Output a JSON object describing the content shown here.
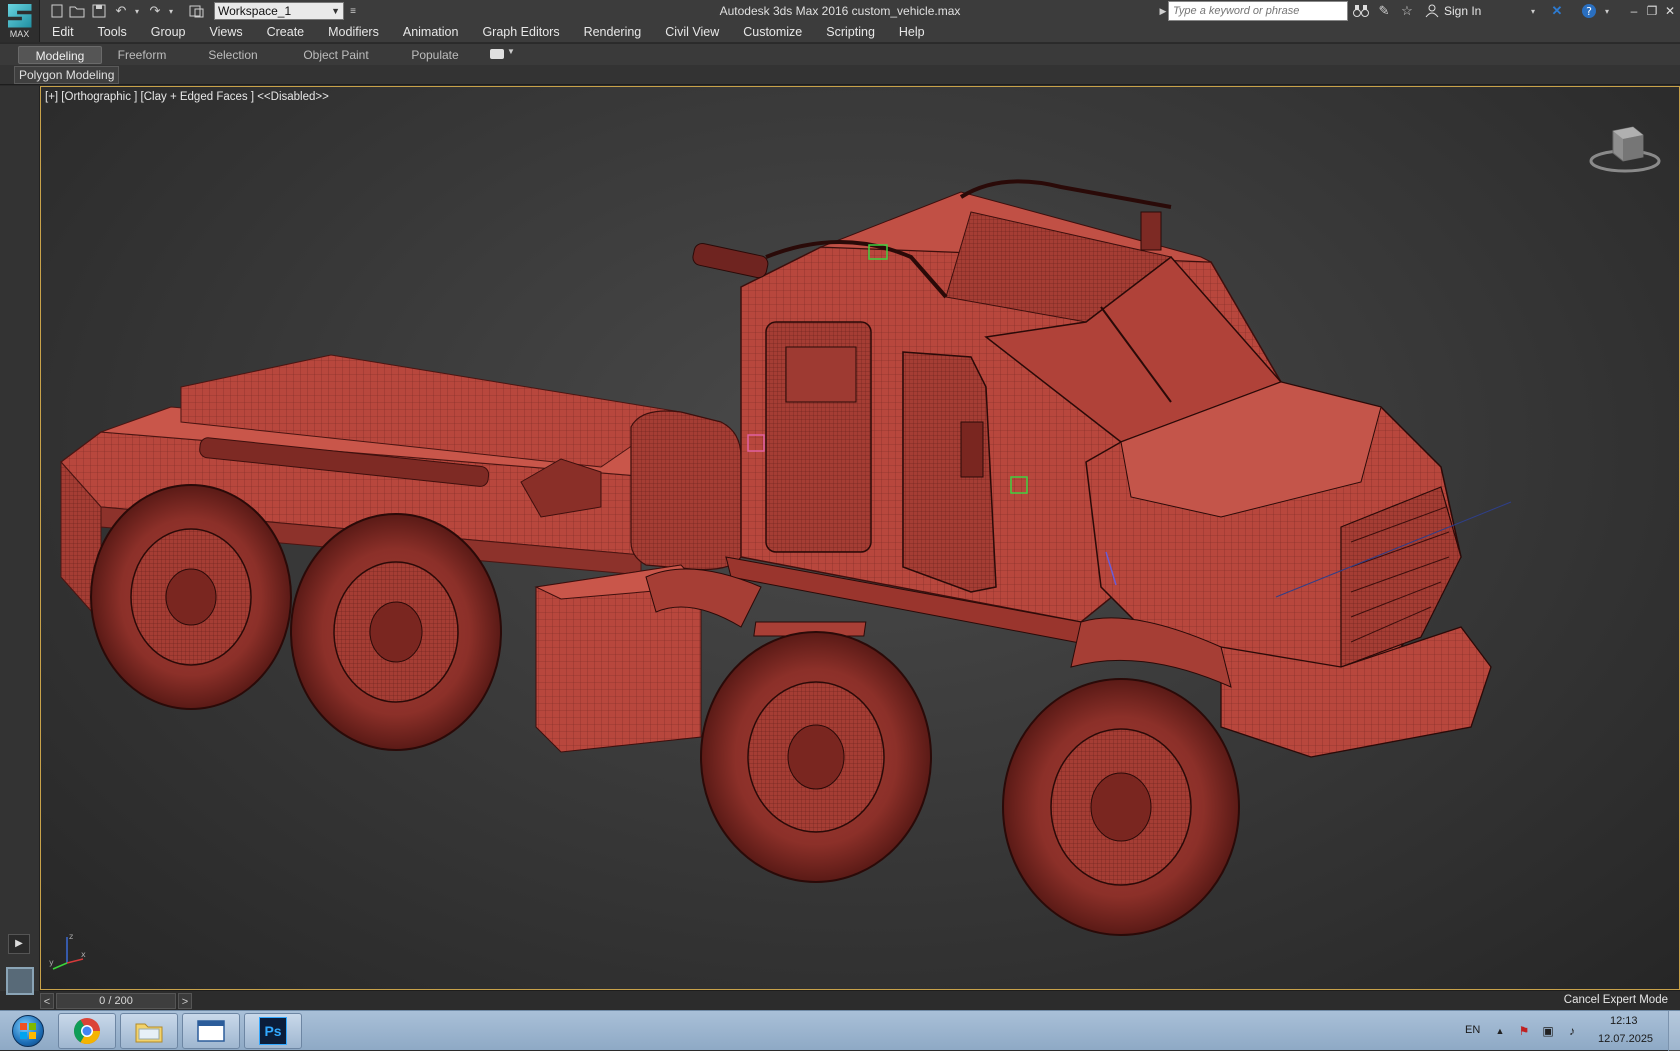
{
  "app": {
    "title": "Autodesk 3ds Max 2016    custom_vehicle.max",
    "logo_text": "MAX",
    "workspace": "Workspace_1",
    "search_placeholder": "Type a keyword or phrase",
    "sign_in": "Sign In"
  },
  "menu": [
    "Edit",
    "Tools",
    "Group",
    "Views",
    "Create",
    "Modifiers",
    "Animation",
    "Graph Editors",
    "Rendering",
    "Civil View",
    "Customize",
    "Scripting",
    "Help"
  ],
  "ribbon": {
    "tabs": [
      "Modeling",
      "Freeform",
      "Selection",
      "Object Paint",
      "Populate"
    ],
    "active": "Modeling",
    "panel_label": "Polygon Modeling"
  },
  "viewport": {
    "label": "[+] [Orthographic ] [Clay + Edged Faces ]   <<Disabled>>",
    "model_color": "#b8473d",
    "wire_color": "#5a1a16",
    "border_color": "#c8a24a",
    "axis_labels": {
      "x": "x",
      "y": "y",
      "z": "z"
    }
  },
  "timeline": {
    "frame": "0 / 200",
    "prev": "<",
    "next": ">",
    "cancel_expert": "Cancel Expert Mode"
  },
  "taskbar": {
    "apps": [
      "chrome-icon",
      "file-explorer-icon",
      "window-icon",
      "photoshop-icon"
    ],
    "ps_label": "Ps",
    "lang": "EN",
    "time": "12:13",
    "date": "12.07.2025"
  }
}
